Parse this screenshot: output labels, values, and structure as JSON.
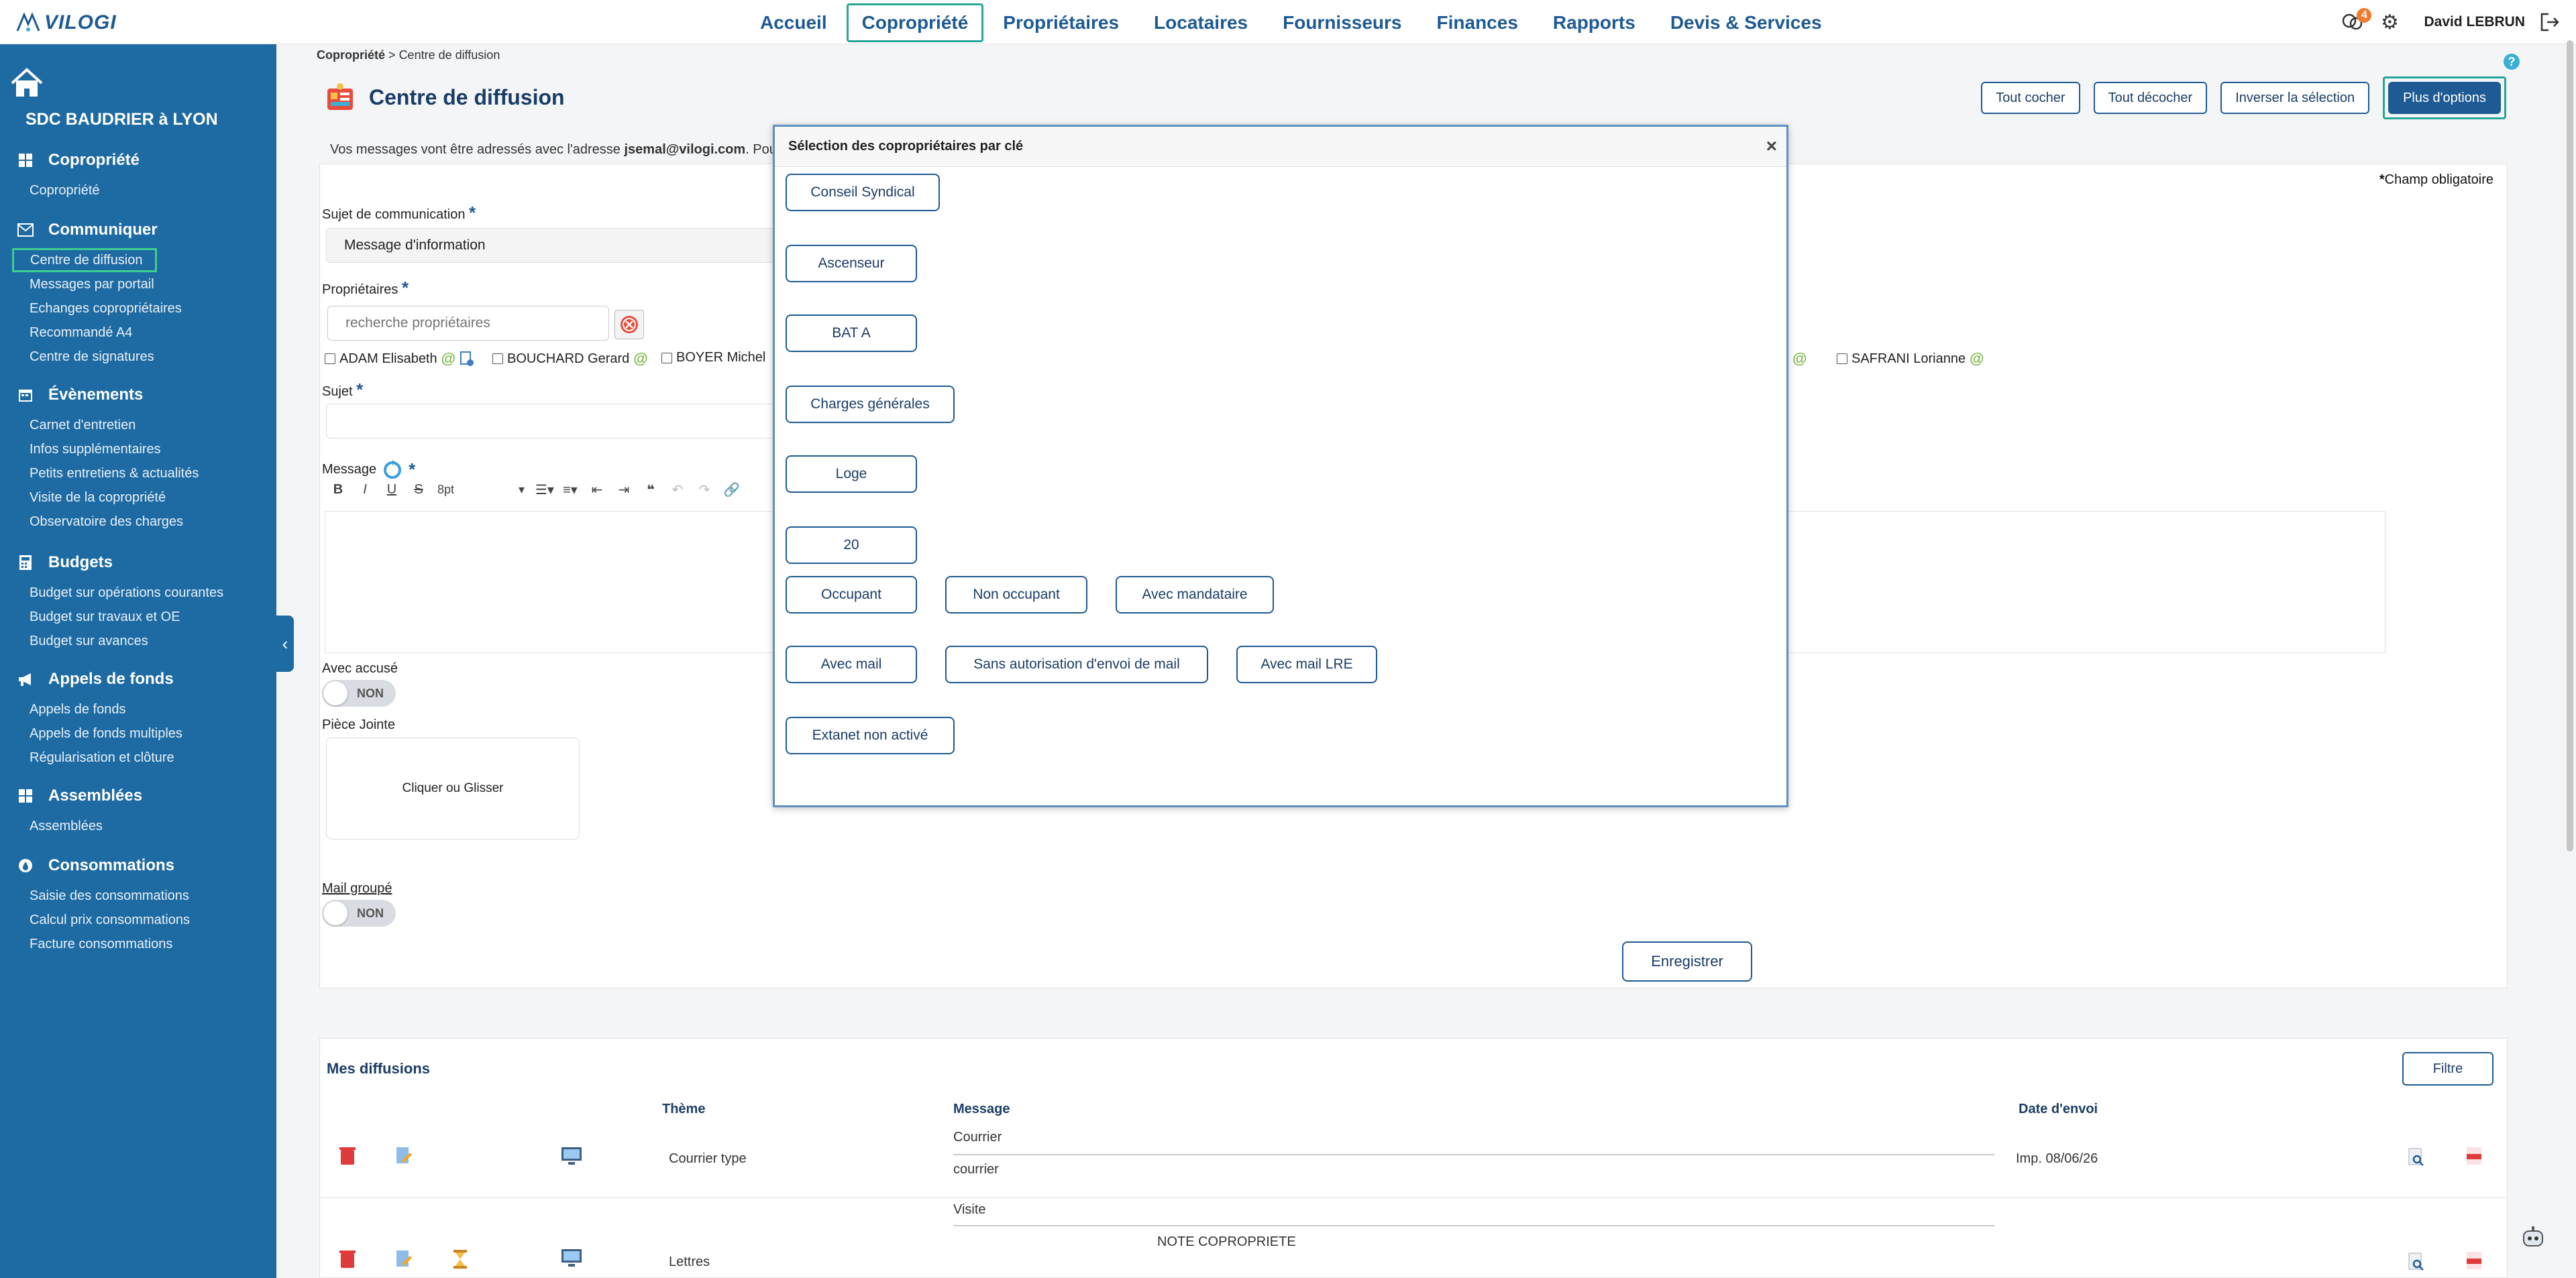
{
  "brand": {
    "logo_text": "VILOGI"
  },
  "topnav": {
    "items": [
      "Accueil",
      "Copropriété",
      "Propriétaires",
      "Locataires",
      "Fournisseurs",
      "Finances",
      "Rapports",
      "Devis & Services"
    ],
    "active": "Copropriété"
  },
  "user": {
    "name": "David LEBRUN",
    "notifications_count": "4"
  },
  "sidebar": {
    "copro_name": "SDC BAUDRIER à LYON",
    "sections": [
      {
        "title": "Copropriété",
        "items": [
          "Copropriété"
        ]
      },
      {
        "title": "Communiquer",
        "items": [
          "Centre de diffusion",
          "Messages par portail",
          "Echanges copropriétaires",
          "Recommandé A4",
          "Centre de signatures"
        ]
      },
      {
        "title": "Évènements",
        "items": [
          "Carnet d'entretien",
          "Infos supplémentaires",
          "Petits entretiens & actualités",
          "Visite de la copropriété",
          "Observatoire des charges"
        ]
      },
      {
        "title": "Budgets",
        "items": [
          "Budget sur opérations courantes",
          "Budget sur travaux et OE",
          "Budget sur avances"
        ]
      },
      {
        "title": "Appels de fonds",
        "items": [
          "Appels de fonds",
          "Appels de fonds multiples",
          "Régularisation et clôture"
        ]
      },
      {
        "title": "Assemblées",
        "items": [
          "Assemblées"
        ]
      },
      {
        "title": "Consommations",
        "items": [
          "Saisie des consommations",
          "Calcul prix consommations",
          "Facture consommations"
        ]
      }
    ]
  },
  "breadcrumb": {
    "root": "Copropriété",
    "sep": ">",
    "current": "Centre de diffusion"
  },
  "page": {
    "title": "Centre de diffusion",
    "info_prefix": "Vos messages vont être adressés avec l'adresse",
    "info_email": "jsemal@vilogi.com",
    "info_suffix": ". Pour la",
    "buttons": {
      "check_all": "Tout cocher",
      "uncheck_all": "Tout décocher",
      "invert": "Inverser la sélection",
      "more": "Plus d'options"
    },
    "help": "?"
  },
  "form": {
    "required_note": "Champ obligatoire",
    "required_star": "*",
    "subject_type_label": "Sujet de communication",
    "subject_type_value": "Message d'information",
    "owners_label": "Propriétaires",
    "owners_search_placeholder": "recherche propriétaires",
    "owners": [
      "ADAM Elisabeth",
      "BOUCHARD Gerard",
      "BOYER Michel",
      "SAFRANI Lorianne"
    ],
    "at_symbol": "@",
    "subject_label": "Sujet",
    "subject_value": "",
    "message_label": "Message",
    "font_size": "8pt",
    "ack_label": "Avec accusé",
    "ack_value": "NON",
    "attachment_label": "Pièce Jointe",
    "attachment_drop": "Cliquer ou Glisser",
    "grouped_label": "Mail groupé",
    "grouped_value": "NON",
    "save": "Enregistrer"
  },
  "diffusions": {
    "title": "Mes diffusions",
    "filter": "Filtre",
    "columns": {
      "theme": "Thème",
      "message": "Message",
      "date": "Date d'envoi"
    },
    "rows": [
      {
        "theme": "Courrier type",
        "message_title": "Courrier",
        "message_body": "courrier",
        "date": "Imp. 08/06/26"
      },
      {
        "theme": "Lettres",
        "message_title": "Visite",
        "message_body": "NOTE COPROPRIETE",
        "date": ""
      }
    ]
  },
  "modal": {
    "title": "Sélection des copropriétaires par clé",
    "close": "×",
    "keys": [
      "Conseil Syndical",
      "Ascenseur",
      "BAT A",
      "Charges générales",
      "Loge",
      "20"
    ],
    "occupancy": [
      "Occupant",
      "Non occupant",
      "Avec mandataire"
    ],
    "mail": [
      "Avec mail",
      "Sans autorisation d'envoi de mail",
      "Avec mail LRE"
    ],
    "extranet": [
      "Extanet non activé"
    ]
  },
  "colors": {
    "primary": "#1e5a93",
    "sidebar": "#1e6ba3",
    "accent": "#26a69a",
    "badge": "#f07b2e"
  }
}
